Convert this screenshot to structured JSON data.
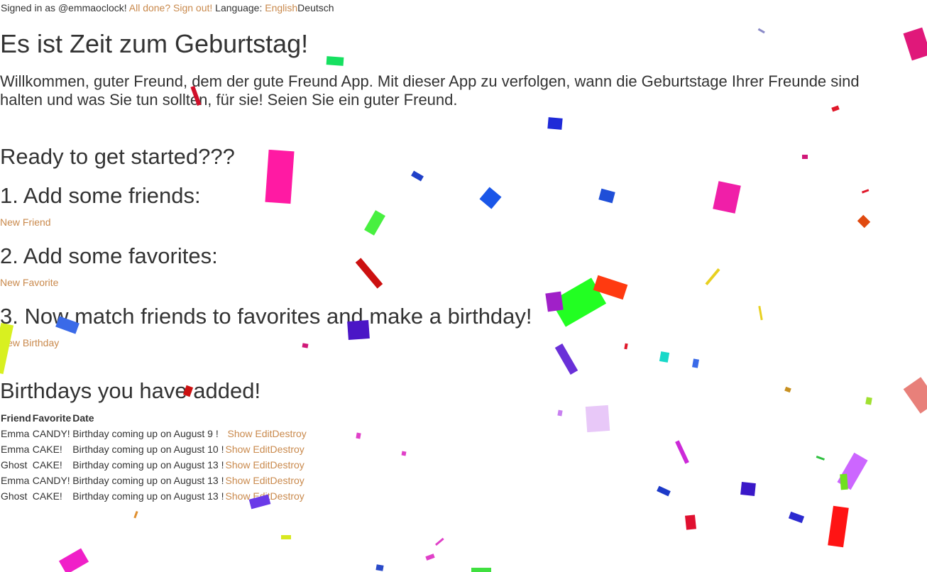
{
  "topbar": {
    "signed_in_text": "Signed in as @emmaoclock!",
    "done_link": "All done? Sign out!",
    "language_label": "Language:",
    "lang_english": "English",
    "lang_deutsch": "Deutsch"
  },
  "main": {
    "title": "Es ist Zeit zum Geburtstag!",
    "intro": "Willkommen, guter Freund, dem der gute Freund App. Mit dieser App zu verfolgen, wann die Geburtstage Ihrer Freunde sind halten und was Sie tun sollten, für sie! Seien Sie ein guter Freund.",
    "ready_heading": "Ready to get started???",
    "step1_heading": "1. Add some friends:",
    "step1_link": "New Friend",
    "step2_heading": "2. Add some favorites:",
    "step2_link": "New Favorite",
    "step3_heading": "3. Now match friends to favorites and make a birthday!",
    "step3_link": "New Birthday",
    "added_heading": "Birthdays you have added!"
  },
  "table": {
    "headers": [
      "Friend",
      "Favorite",
      "Date"
    ],
    "action_labels": {
      "show": "Show",
      "edit": "Edit",
      "destroy": "Destroy"
    },
    "rows": [
      {
        "friend": "Emma",
        "favorite": "CANDY!",
        "date": "Birthday coming up on August 9 !"
      },
      {
        "friend": "Emma",
        "favorite": "CAKE!",
        "date": "Birthday coming up on August 10 !"
      },
      {
        "friend": "Ghost",
        "favorite": "CAKE!",
        "date": "Birthday coming up on August 13 !"
      },
      {
        "friend": "Emma",
        "favorite": "CANDY!",
        "date": "Birthday coming up on August 13 !"
      },
      {
        "friend": "Ghost",
        "favorite": "CAKE!",
        "date": "Birthday coming up on August 13 !"
      }
    ]
  },
  "colors": {
    "link": "#c9894c",
    "text": "#333333"
  }
}
